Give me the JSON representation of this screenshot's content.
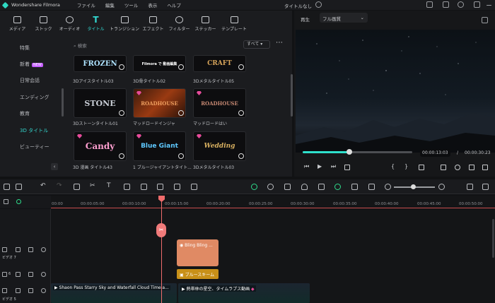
{
  "titlebar": {
    "app_name": "Wondershare Filmora",
    "menu": [
      "ファイル",
      "編集",
      "ツール",
      "表示",
      "ヘルプ"
    ],
    "project_title": "タイトルなし"
  },
  "toolbar": {
    "items": [
      {
        "label": "メディア",
        "icon": "media-icon"
      },
      {
        "label": "ストック",
        "icon": "stock-icon"
      },
      {
        "label": "オーディオ",
        "icon": "music-note-icon"
      },
      {
        "label": "タイトル",
        "icon": "title-t-icon"
      },
      {
        "label": "トランジション",
        "icon": "transition-icon"
      },
      {
        "label": "エフェクト",
        "icon": "effect-icon"
      },
      {
        "label": "フィルター",
        "icon": "filter-icon"
      },
      {
        "label": "ステッカー",
        "icon": "sticker-icon"
      },
      {
        "label": "テンプレート",
        "icon": "template-icon"
      }
    ],
    "active_index": 3,
    "accent": "#32d7d0"
  },
  "sidebar": {
    "items": [
      "特集",
      "新着",
      "日常会話",
      "エンディング",
      "教育",
      "3D タイトル",
      "ビューティー"
    ],
    "new_badge": "NEW",
    "active_index": 5
  },
  "content": {
    "search_placeholder": "検索",
    "filter_value": "すべて",
    "thumbnails": [
      {
        "text": "FROZEN",
        "label": "3Dアイスタイトル03",
        "gem": false
      },
      {
        "text": "Filmora で 動画編集",
        "label": "3D骨タイトル02",
        "gem": false
      },
      {
        "text": "CRAFT",
        "label": "3Dメタルタイトル05",
        "gem": false
      },
      {
        "text": "STONE",
        "label": "3Dストーンタイトル01",
        "gem": false
      },
      {
        "text": "ROADHOUSE",
        "label": "マッドロードインジャ",
        "gem": true
      },
      {
        "text": "ROADHOUSE",
        "label": "マッドロードはい",
        "gem": true
      },
      {
        "text": "Candy",
        "label": "3D 漫画 タイトル43",
        "gem": true
      },
      {
        "text": "Blue Giant",
        "label": "1 ブルージャイアントタイト...",
        "gem": true
      },
      {
        "text": "Wedding",
        "label": "3Dメタルタイトル03",
        "gem": true
      }
    ]
  },
  "preview": {
    "label": "再生",
    "quality": "フル画質",
    "current_time": "00:00:13:03",
    "total_time": "00:00:30:23",
    "progress_fraction": 0.43
  },
  "timeline": {
    "ruler_ticks": [
      "00:00",
      "00:00:05:00",
      "00:00:10:00",
      "00:00:15:00",
      "00:00:20:00",
      "00:00:25:00",
      "00:00:30:00",
      "00:00:35:00",
      "00:00:40:00",
      "00:00:45:00",
      "00:00:50:00"
    ],
    "tracks": [
      "ビデオ 7",
      "6",
      "ビデオ 5"
    ],
    "clips": {
      "title_clip": "Bling Bling ...",
      "effect_clip": "ブルースキーム",
      "video_clip_1": "Shaon Pass Starry Sky and Waterfall Cloud Timela...",
      "video_clip_2": "熱帯林の星空、タイムラプス動画"
    }
  }
}
